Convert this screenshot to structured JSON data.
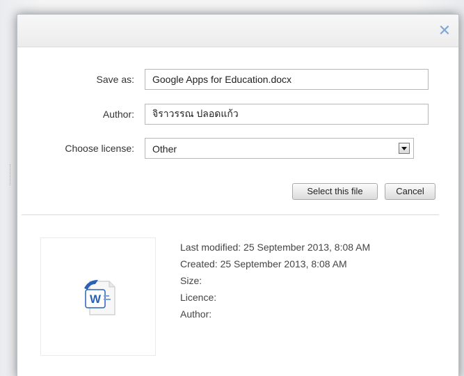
{
  "dialog": {
    "close_glyph": "✕"
  },
  "form": {
    "save_as_label": "Save as:",
    "save_as_value": "Google Apps for Education.docx",
    "author_label": "Author:",
    "author_value": "จิราวรรณ ปลอดแก้ว",
    "license_label": "Choose license:",
    "license_selected": "Other"
  },
  "buttons": {
    "select_file": "Select this file",
    "cancel": "Cancel"
  },
  "details": {
    "last_modified": "Last modified: 25 September 2013, 8:08 AM",
    "created": "Created: 25 September 2013, 8:08 AM",
    "size": "Size:",
    "licence": "Licence:",
    "author": "Author:"
  },
  "icons": {
    "close": "close-icon",
    "file_type": "word-document-icon",
    "dropdown": "chevron-down-icon"
  },
  "colors": {
    "close_icon": "#7ea6d8",
    "word_blue": "#2a61b8"
  }
}
